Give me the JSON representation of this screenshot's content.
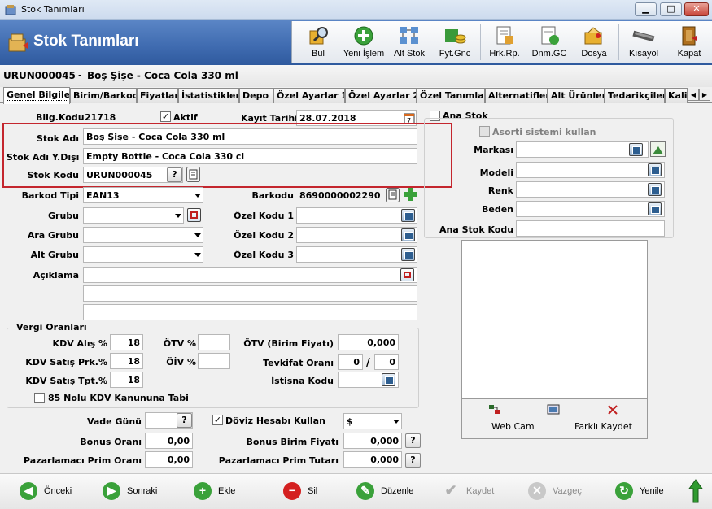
{
  "window": {
    "title": "Stok Tanımları",
    "minimize": "▁",
    "restore": "□",
    "close": "✕"
  },
  "header": {
    "title": "Stok Tanımları"
  },
  "toolbar": [
    {
      "label": "Bul",
      "icon": "find-icon"
    },
    {
      "label": "Yeni İşlem",
      "icon": "add-icon"
    },
    {
      "label": "Alt Stok",
      "icon": "sub-stock-icon"
    },
    {
      "label": "Fyt.Gnc",
      "icon": "price-update-icon"
    },
    {
      "label": "Hrk.Rp.",
      "icon": "movement-report-icon"
    },
    {
      "label": "Dnm.GC",
      "icon": "period-icon"
    },
    {
      "label": "Dosya",
      "icon": "file-icon"
    },
    {
      "label": "Kısayol",
      "icon": "shortcut-icon"
    },
    {
      "label": "Kapat",
      "icon": "exit-icon"
    }
  ],
  "record": {
    "code": "URUN000045",
    "separator": "-",
    "name": "Boş Şişe - Coca Cola 330 ml"
  },
  "tabs": [
    "Genel Bilgiler",
    "Birim/Barkod",
    "Fiyatlar",
    "İstatistikler",
    "Depo",
    "Özel Ayarlar 1",
    "Özel Ayarlar 2",
    "Özel Tanımlar",
    "Alternatifler",
    "Alt Ürünler",
    "Tedarikçiler",
    "Kali"
  ],
  "form": {
    "bilg_kodu_label": "Bilg.Kodu",
    "bilg_kodu": "21718",
    "aktif_label": "Aktif",
    "aktif_check": "✓",
    "kayit_tarihi_label": "Kayıt Tarihi",
    "kayit_tarihi": "28.07.2018",
    "ana_stok_label": "Ana Stok",
    "stok_adi_label": "Stok Adı",
    "stok_adi": "Boş Şişe - Coca Cola 330 ml",
    "stok_adi_ydisi_label": "Stok Adı Y.Dışı",
    "stok_adi_ydisi": "Empty Bottle - Coca Cola 330 cl",
    "stok_kodu_label": "Stok Kodu",
    "stok_kodu": "URUN000045",
    "help_q": "?",
    "barkod_tipi_label": "Barkod Tipi",
    "barkod_tipi": "EAN13",
    "barkodu_label": "Barkodu",
    "barkodu": "8690000002290",
    "grubu_label": "Grubu",
    "ara_grubu_label": "Ara Grubu",
    "alt_grubu_label": "Alt Grubu",
    "ozel_kodu1_label": "Özel Kodu 1",
    "ozel_kodu2_label": "Özel Kodu 2",
    "ozel_kodu3_label": "Özel Kodu 3",
    "aciklama_label": "Açıklama",
    "asorti_label": "Asorti sistemi kullan",
    "markasi_label": "Markası",
    "modeli_label": "Modeli",
    "renk_label": "Renk",
    "beden_label": "Beden",
    "ana_stok_kodu_label": "Ana Stok Kodu",
    "webcam_label": "Web Cam",
    "farkli_kaydet_label": "Farklı Kaydet"
  },
  "vergi": {
    "title": "Vergi Oranları",
    "kdv_alis_label": "KDV Alış %",
    "kdv_alis": "18",
    "kdv_satis_prk_label": "KDV Satış Prk.%",
    "kdv_satis_prk": "18",
    "kdv_satis_tpt_label": "KDV Satış Tpt.%",
    "kdv_satis_tpt": "18",
    "otv_label": "ÖTV %",
    "oiv_label": "ÖİV %",
    "otv_birim_label": "ÖTV (Birim Fiyatı)",
    "otv_birim": "0,000",
    "tevkifat_label": "Tevkifat Oranı",
    "tevkifat_a": "0",
    "tevkifat_sep": "/",
    "tevkifat_b": "0",
    "istisna_label": "İstisna Kodu",
    "kdv85_label": "85 Nolu KDV Kanununa Tabi"
  },
  "bottom_form": {
    "vade_label": "Vade Günü",
    "doviz_label": "Döviz Hesabı Kullan",
    "doviz_check": "✓",
    "doviz_value": "$",
    "bonus_orani_label": "Bonus Oranı",
    "bonus_orani": "0,00",
    "bonus_birim_label": "Bonus Birim Fiyatı",
    "bonus_birim": "0,000",
    "prim_orani_label": "Pazarlamacı Prim Oranı",
    "prim_orani": "0,00",
    "prim_tutari_label": "Pazarlamacı Prim Tutarı",
    "prim_tutari": "0,000"
  },
  "nav": {
    "onceki": "Önceki",
    "sonraki": "Sonraki",
    "ekle": "Ekle",
    "sil": "Sil",
    "duzenle": "Düzenle",
    "kaydet": "Kaydet",
    "vazgec": "Vazgeç",
    "yenile": "Yenile"
  },
  "colors": {
    "header": "#3f6bb0",
    "highlight_box": "#c4262e",
    "green": "#3aa13a",
    "red": "#d42020"
  }
}
